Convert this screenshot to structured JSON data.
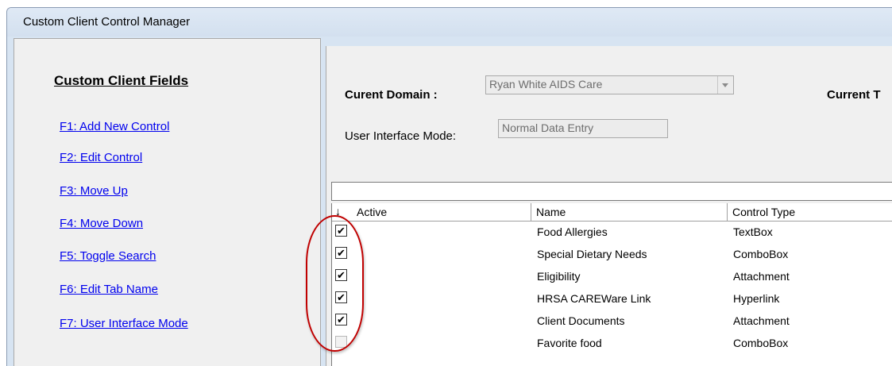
{
  "window": {
    "title": "Custom Client Control Manager"
  },
  "left_panel": {
    "heading": "Custom Client Fields",
    "links": [
      {
        "label": "F1: Add New Control"
      },
      {
        "label": "F2: Edit Control"
      },
      {
        "label": "F3: Move Up"
      },
      {
        "label": "F4: Move Down"
      },
      {
        "label": "F5: Toggle Search"
      },
      {
        "label": "F6: Edit Tab Name"
      },
      {
        "label": "F7: User Interface Mode"
      }
    ]
  },
  "domain": {
    "label": "Curent Domain :",
    "value": "Ryan White AIDS Care",
    "current_label": "Current T"
  },
  "ui_mode": {
    "label": "User Interface Mode:",
    "value": "Normal Data Entry"
  },
  "grid": {
    "columns": [
      "Active",
      "Name",
      "Control Type"
    ],
    "rows": [
      {
        "active": true,
        "name": "Food Allergies",
        "type": "TextBox"
      },
      {
        "active": true,
        "name": "Special Dietary Needs",
        "type": "ComboBox"
      },
      {
        "active": true,
        "name": "Eligibility",
        "type": "Attachment"
      },
      {
        "active": true,
        "name": "HRSA CAREWare Link",
        "type": "Hyperlink"
      },
      {
        "active": true,
        "name": "Client Documents",
        "type": "Attachment"
      },
      {
        "active": false,
        "name": "Favorite food",
        "type": "ComboBox"
      }
    ]
  },
  "icons": {
    "sort": "sort-down-arrow-icon",
    "dropdown": "chevron-down-icon",
    "checkbox": "check-icon"
  },
  "colors": {
    "link": "#0000ee",
    "highlight": "#c00000",
    "titlebar": "#d7e4f2"
  }
}
